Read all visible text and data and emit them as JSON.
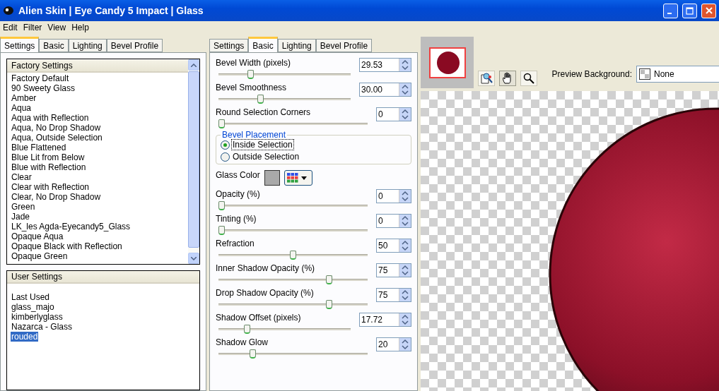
{
  "window": {
    "title": "Alien Skin | Eye Candy 5 Impact | Glass"
  },
  "menu": [
    "Edit",
    "Filter",
    "View",
    "Help"
  ],
  "settings_panel": {
    "tabs": [
      {
        "label": "Settings",
        "selected": true
      },
      {
        "label": "Basic",
        "selected": false
      },
      {
        "label": "Lighting",
        "selected": false
      },
      {
        "label": "Bevel Profile",
        "selected": false
      }
    ],
    "factory_settings": {
      "header": "Factory Settings",
      "items": [
        {
          "label": "Factory Default",
          "selected": false
        },
        {
          "label": "90 Sweety Glass",
          "selected": false
        },
        {
          "label": "Amber",
          "selected": false
        },
        {
          "label": "Aqua",
          "selected": false
        },
        {
          "label": "Aqua with Reflection",
          "selected": false
        },
        {
          "label": "Aqua, No Drop Shadow",
          "selected": false
        },
        {
          "label": "Aqua, Outside Selection",
          "selected": false
        },
        {
          "label": "Blue Flattened",
          "selected": false
        },
        {
          "label": "Blue Lit from Below",
          "selected": false
        },
        {
          "label": "Blue with Reflection",
          "selected": false
        },
        {
          "label": "Clear",
          "selected": false
        },
        {
          "label": "Clear with Reflection",
          "selected": false
        },
        {
          "label": "Clear, No Drop Shadow",
          "selected": false
        },
        {
          "label": "Green",
          "selected": false
        },
        {
          "label": "Jade",
          "selected": false
        },
        {
          "label": "LK_les Agda-Eyecandy5_Glass",
          "selected": false
        },
        {
          "label": "Opaque Aqua",
          "selected": false
        },
        {
          "label": "Opaque Black with Reflection",
          "selected": false
        },
        {
          "label": "Opaque Green",
          "selected": false
        }
      ]
    },
    "user_settings": {
      "header": "User Settings",
      "items": [
        {
          "label": "Last Used",
          "selected": false
        },
        {
          "label": "glass_majo",
          "selected": false
        },
        {
          "label": "kimberlyglass",
          "selected": false
        },
        {
          "label": "Nazarca - Glass",
          "selected": false
        },
        {
          "label": "rouded",
          "selected": true
        }
      ]
    }
  },
  "basic_panel": {
    "tabs": [
      {
        "label": "Settings",
        "selected": false
      },
      {
        "label": "Basic",
        "selected": true
      },
      {
        "label": "Lighting",
        "selected": false
      },
      {
        "label": "Bevel Profile",
        "selected": false
      }
    ],
    "controls": [
      {
        "kind": "slider",
        "label": "Bevel Width (pixels)",
        "value": "29.53",
        "level": 0.23
      },
      {
        "kind": "slider",
        "label": "Bevel Smoothness",
        "value": "30.00",
        "level": 0.31
      },
      {
        "kind": "slider",
        "label": "Round Selection Corners",
        "value": "0",
        "level": 0
      },
      {
        "kind": "radio_group",
        "title": "Bevel Placement",
        "options": [
          {
            "label": "Inside Selection",
            "selected": true
          },
          {
            "label": "Outside Selection",
            "selected": false
          }
        ]
      },
      {
        "kind": "color",
        "label": "Glass Color"
      },
      {
        "kind": "slider",
        "label": "Opacity (%)",
        "value": "0",
        "level": 0
      },
      {
        "kind": "slider",
        "label": "Tinting (%)",
        "value": "0",
        "level": 0
      },
      {
        "kind": "slider",
        "label": "Refraction",
        "value": "50",
        "level": 0.5
      },
      {
        "kind": "slider",
        "label": "Inner Shadow Opacity (%)",
        "value": "75",
        "level": 0.75
      },
      {
        "kind": "slider",
        "label": "Drop Shadow Opacity (%)",
        "value": "75",
        "level": 0.75
      },
      {
        "kind": "slider",
        "label": "Shadow Offset (pixels)",
        "value": "17.72",
        "level": 0.2
      },
      {
        "kind": "slider",
        "label": "Shadow Glow",
        "value": "20",
        "level": 0.22
      }
    ]
  },
  "preview": {
    "tools": [
      {
        "kind": "navigator",
        "selected": false
      },
      {
        "kind": "hand",
        "selected": true
      },
      {
        "kind": "zoom",
        "selected": false
      }
    ],
    "background_label": "Preview Background:",
    "background_value": "None"
  }
}
